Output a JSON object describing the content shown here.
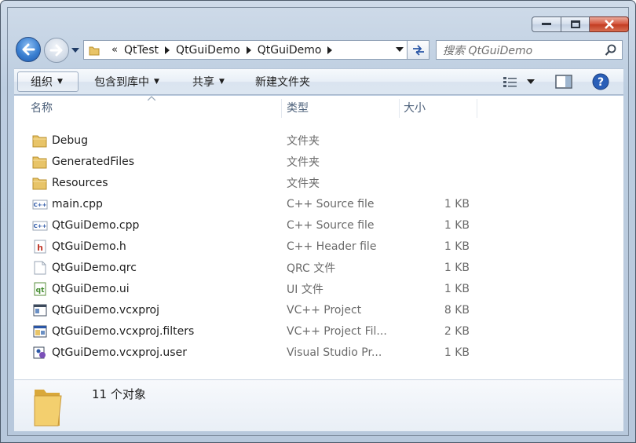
{
  "window": {
    "caption_buttons": [
      "minimize",
      "maximize",
      "close"
    ]
  },
  "address": {
    "overflow": "«",
    "crumbs": [
      "QtTest",
      "QtGuiDemo",
      "QtGuiDemo"
    ]
  },
  "search": {
    "placeholder": "搜索 QtGuiDemo"
  },
  "toolbar": {
    "organize": "组织",
    "include_library": "包含到库中",
    "share": "共享",
    "new_folder": "新建文件夹"
  },
  "columns": {
    "name": "名称",
    "type": "类型",
    "size": "大小"
  },
  "files": [
    {
      "name": "Debug",
      "type": "文件夹",
      "size": "",
      "icon": "folder-icon"
    },
    {
      "name": "GeneratedFiles",
      "type": "文件夹",
      "size": "",
      "icon": "folder-icon"
    },
    {
      "name": "Resources",
      "type": "文件夹",
      "size": "",
      "icon": "folder-icon"
    },
    {
      "name": "main.cpp",
      "type": "C++ Source file",
      "size": "1 KB",
      "icon": "cpp-file-icon"
    },
    {
      "name": "QtGuiDemo.cpp",
      "type": "C++ Source file",
      "size": "1 KB",
      "icon": "cpp-file-icon"
    },
    {
      "name": "QtGuiDemo.h",
      "type": "C++ Header file",
      "size": "1 KB",
      "icon": "header-file-icon"
    },
    {
      "name": "QtGuiDemo.qrc",
      "type": "QRC 文件",
      "size": "1 KB",
      "icon": "blank-file-icon"
    },
    {
      "name": "QtGuiDemo.ui",
      "type": "UI 文件",
      "size": "1 KB",
      "icon": "ui-file-icon"
    },
    {
      "name": "QtGuiDemo.vcxproj",
      "type": "VC++ Project",
      "size": "8 KB",
      "icon": "vcxproj-file-icon"
    },
    {
      "name": "QtGuiDemo.vcxproj.filters",
      "type": "VC++ Project Fil...",
      "size": "2 KB",
      "icon": "filters-file-icon"
    },
    {
      "name": "QtGuiDemo.vcxproj.user",
      "type": "Visual Studio Pr...",
      "size": "1 KB",
      "icon": "vs-user-file-icon"
    }
  ],
  "details": {
    "count": "11 个对象"
  },
  "colors": {
    "accent": "#3a7fd0",
    "folder": "#e8c468",
    "close": "#c23c22"
  }
}
